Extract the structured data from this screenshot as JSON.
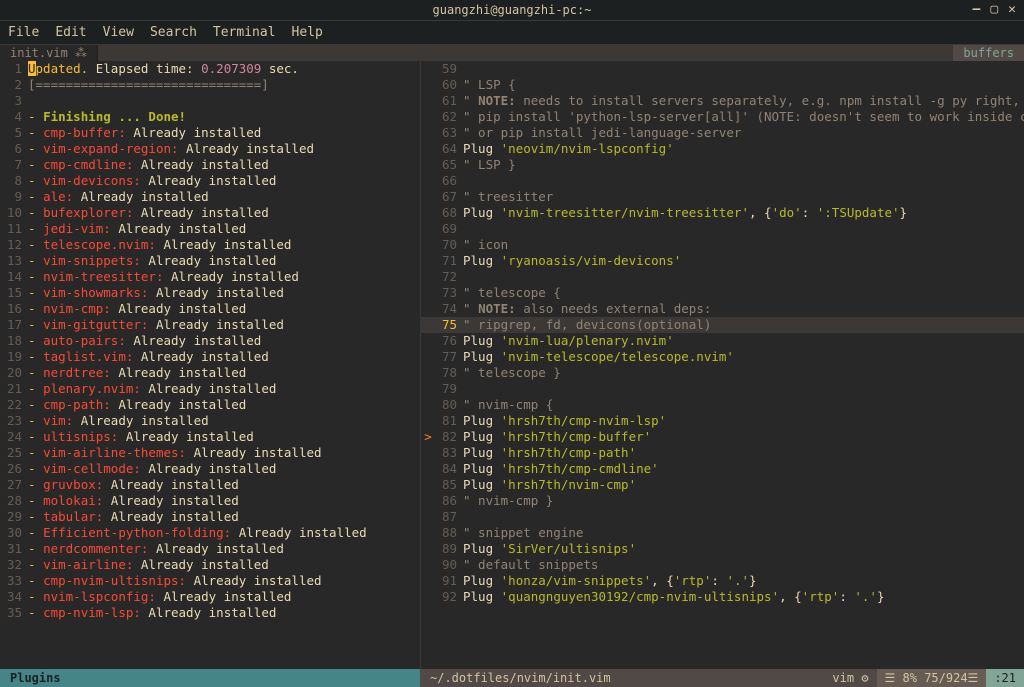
{
  "window": {
    "title": "guangzhi@guangzhi-pc:~"
  },
  "menu": {
    "file": "File",
    "edit": "Edit",
    "view": "View",
    "search": "Search",
    "terminal": "Terminal",
    "help": "Help"
  },
  "tabs": {
    "main": "init.vim",
    "pin": "⁂",
    "buffers": "buffers"
  },
  "left_pane": {
    "lines": [
      {
        "n": 1,
        "prefix_hl": "U",
        "rest": "pdated. ",
        "seg2": "Elapsed time:",
        "seg3": " 0.207309 ",
        "seg4": "sec."
      },
      {
        "n": 2,
        "raw": "[==============================]",
        "cls": "text-grey"
      },
      {
        "n": 3,
        "raw": ""
      },
      {
        "n": 4,
        "dash": "- ",
        "name": "Finishing ... Done!",
        "done": true
      },
      {
        "n": 5,
        "dash": "- ",
        "name": "cmp-buffer:",
        "msg": " Already installed"
      },
      {
        "n": 6,
        "dash": "- ",
        "name": "vim-expand-region:",
        "msg": " Already installed"
      },
      {
        "n": 7,
        "dash": "- ",
        "name": "cmp-cmdline:",
        "msg": " Already installed"
      },
      {
        "n": 8,
        "dash": "- ",
        "name": "vim-devicons:",
        "msg": " Already installed"
      },
      {
        "n": 9,
        "dash": "- ",
        "name": "ale:",
        "msg": " Already installed"
      },
      {
        "n": 10,
        "dash": "- ",
        "name": "bufexplorer:",
        "msg": " Already installed"
      },
      {
        "n": 11,
        "dash": "- ",
        "name": "jedi-vim:",
        "msg": " Already installed"
      },
      {
        "n": 12,
        "dash": "- ",
        "name": "telescope.nvim:",
        "msg": " Already installed"
      },
      {
        "n": 13,
        "dash": "- ",
        "name": "vim-snippets:",
        "msg": " Already installed"
      },
      {
        "n": 14,
        "dash": "- ",
        "name": "nvim-treesitter:",
        "msg": " Already installed"
      },
      {
        "n": 15,
        "dash": "- ",
        "name": "vim-showmarks:",
        "msg": " Already installed"
      },
      {
        "n": 16,
        "dash": "- ",
        "name": "nvim-cmp:",
        "msg": " Already installed"
      },
      {
        "n": 17,
        "dash": "- ",
        "name": "vim-gitgutter:",
        "msg": " Already installed"
      },
      {
        "n": 18,
        "dash": "- ",
        "name": "auto-pairs:",
        "msg": " Already installed"
      },
      {
        "n": 19,
        "dash": "- ",
        "name": "taglist.vim:",
        "msg": " Already installed"
      },
      {
        "n": 20,
        "dash": "- ",
        "name": "nerdtree:",
        "msg": " Already installed"
      },
      {
        "n": 21,
        "dash": "- ",
        "name": "plenary.nvim:",
        "msg": " Already installed"
      },
      {
        "n": 22,
        "dash": "- ",
        "name": "cmp-path:",
        "msg": " Already installed"
      },
      {
        "n": 23,
        "dash": "- ",
        "name": "vim:",
        "msg": " Already installed"
      },
      {
        "n": 24,
        "dash": "- ",
        "name": "ultisnips:",
        "msg": " Already installed"
      },
      {
        "n": 25,
        "dash": "- ",
        "name": "vim-airline-themes:",
        "msg": " Already installed"
      },
      {
        "n": 26,
        "dash": "- ",
        "name": "vim-cellmode:",
        "msg": " Already installed"
      },
      {
        "n": 27,
        "dash": "- ",
        "name": "gruvbox:",
        "msg": " Already installed"
      },
      {
        "n": 28,
        "dash": "- ",
        "name": "molokai:",
        "msg": " Already installed"
      },
      {
        "n": 29,
        "dash": "- ",
        "name": "tabular:",
        "msg": " Already installed"
      },
      {
        "n": 30,
        "dash": "- ",
        "name": "Efficient-python-folding:",
        "msg": " Already installed"
      },
      {
        "n": 31,
        "dash": "- ",
        "name": "nerdcommenter:",
        "msg": " Already installed"
      },
      {
        "n": 32,
        "dash": "- ",
        "name": "vim-airline:",
        "msg": " Already installed"
      },
      {
        "n": 33,
        "dash": "- ",
        "name": "cmp-nvim-ultisnips:",
        "msg": " Already installed"
      },
      {
        "n": 34,
        "dash": "- ",
        "name": "nvim-lspconfig:",
        "msg": " Already installed"
      },
      {
        "n": 35,
        "dash": "- ",
        "name": "cmp-nvim-lsp:",
        "msg": " Already installed"
      }
    ]
  },
  "right_pane": {
    "lines": [
      {
        "n": 59,
        "raw": ""
      },
      {
        "n": 60,
        "cmt": "\" LSP {"
      },
      {
        "n": 61,
        "cmt": "\" ",
        "bold": "NOTE:",
        "rest": " needs to install servers separately, e.g. npm install -g py right, or"
      },
      {
        "n": 62,
        "cmt": "\" pip install 'python-lsp-server[all]' (NOTE: doesn't seem to work inside conda env),"
      },
      {
        "n": 63,
        "cmt": "\" or pip install jedi-language-server"
      },
      {
        "n": 64,
        "plug": "Plug ",
        "str": "'neovim/nvim-lspconfig'"
      },
      {
        "n": 65,
        "cmt": "\" LSP }"
      },
      {
        "n": 66,
        "raw": ""
      },
      {
        "n": 67,
        "cmt": "\" treesitter"
      },
      {
        "n": 68,
        "plug": "Plug ",
        "str": "'nvim-treesitter/nvim-treesitter'",
        "extra": ", {'do': ':TSUpdate'}"
      },
      {
        "n": 69,
        "raw": ""
      },
      {
        "n": 70,
        "cmt": "\" icon"
      },
      {
        "n": 71,
        "plug": "Plug ",
        "str": "'ryanoasis/vim-devicons'"
      },
      {
        "n": 72,
        "raw": ""
      },
      {
        "n": 73,
        "cmt": "\" telescope {"
      },
      {
        "n": 74,
        "cmt": "\" ",
        "bold": "NOTE:",
        "rest": " also needs external deps:"
      },
      {
        "n": 75,
        "cmt": "\" ripgrep, fd, devicons(optional)",
        "hl": true,
        "current": true
      },
      {
        "n": 76,
        "plug": "Plug ",
        "str": "'nvim-lua/plenary.nvim'"
      },
      {
        "n": 77,
        "plug": "Plug ",
        "str": "'nvim-telescope/telescope.nvim'"
      },
      {
        "n": 78,
        "cmt": "\" telescope }"
      },
      {
        "n": 79,
        "raw": ""
      },
      {
        "n": 80,
        "cmt": "\" nvim-cmp {"
      },
      {
        "n": 81,
        "plug": "Plug ",
        "str": "'hrsh7th/cmp-nvim-lsp'"
      },
      {
        "n": 82,
        "plug": "Plug ",
        "str": "'hrsh7th/cmp-buffer'",
        "arrow": true
      },
      {
        "n": 83,
        "plug": "Plug ",
        "str": "'hrsh7th/cmp-path'"
      },
      {
        "n": 84,
        "plug": "Plug ",
        "str": "'hrsh7th/cmp-cmdline'"
      },
      {
        "n": 85,
        "plug": "Plug ",
        "str": "'hrsh7th/nvim-cmp'"
      },
      {
        "n": 86,
        "cmt": "\" nvim-cmp }"
      },
      {
        "n": 87,
        "raw": ""
      },
      {
        "n": 88,
        "cmt": "\" snippet engine"
      },
      {
        "n": 89,
        "plug": "Plug ",
        "str": "'SirVer/ultisnips'"
      },
      {
        "n": 90,
        "cmt": "\" default snippets"
      },
      {
        "n": 91,
        "plug": "Plug ",
        "str": "'honza/vim-snippets'",
        "extra": ", {'rtp': '.'}"
      },
      {
        "n": 92,
        "plug": "Plug ",
        "str": "'quangnguyen30192/cmp-nvim-ultisnips'",
        "extra": ", {'rtp': '.'}"
      }
    ]
  },
  "status": {
    "left": "Plugins",
    "path": "~/.dotfiles/nvim/init.vim",
    "ft": "vim ⚙",
    "pos": "☰  8% 75/924☰",
    "col": " :21"
  }
}
